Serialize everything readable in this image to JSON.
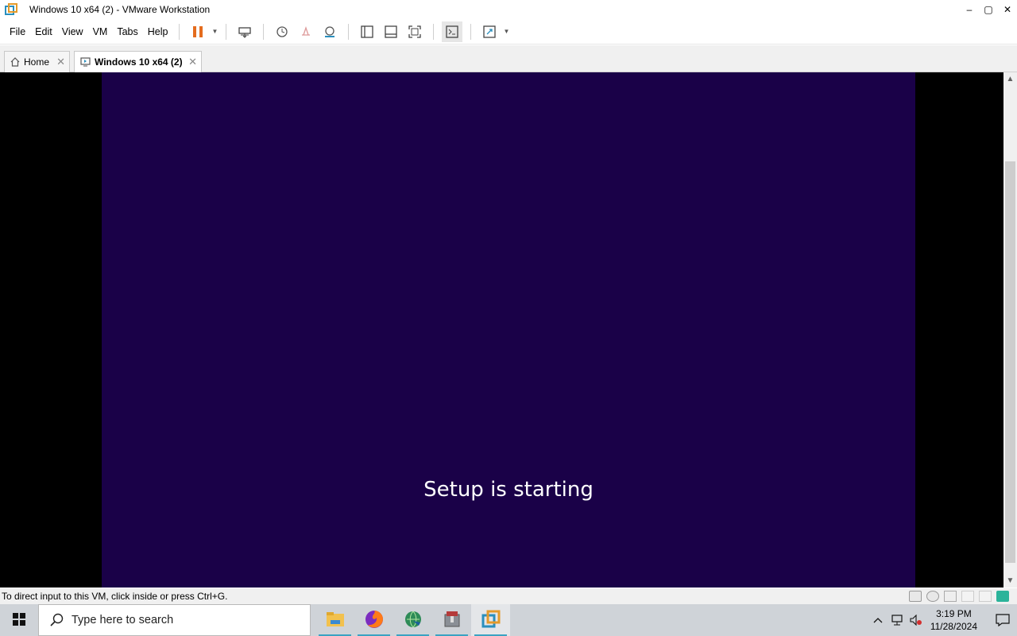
{
  "window": {
    "title": "Windows 10 x64 (2) - VMware Workstation",
    "controls": {
      "minimize": "–",
      "maximize": "▢",
      "close": "✕"
    }
  },
  "menu": {
    "items": [
      {
        "label": "File"
      },
      {
        "label": "Edit"
      },
      {
        "label": "View"
      },
      {
        "label": "VM"
      },
      {
        "label": "Tabs"
      },
      {
        "label": "Help"
      }
    ]
  },
  "toolbar": {
    "icons": [
      "pause-icon",
      "dropdown-icon",
      "send-ctrl-alt-del-icon",
      "snapshot-icon",
      "revert-snapshot-icon",
      "snapshot-manager-icon",
      "show-library-icon",
      "thumbnail-bar-icon",
      "fit-guest-icon",
      "console-view-icon",
      "full-screen-icon",
      "dropdown-icon"
    ],
    "accent": "#e46c1e"
  },
  "tabs": [
    {
      "label": "Home",
      "close": "✕",
      "icon": "home-icon"
    },
    {
      "label": "Windows 10 x64 (2)",
      "close": "✕",
      "icon": "vm-icon",
      "active": true
    }
  ],
  "guest": {
    "message": "Setup is starting",
    "background": "#1a0148"
  },
  "status": {
    "message": "To direct input to this VM, click inside or press Ctrl+G."
  },
  "taskbar": {
    "search_placeholder": "Type here to search",
    "apps": [
      "file-explorer-icon",
      "firefox-icon",
      "internet-download-manager-icon",
      "archive-app-icon",
      "vmware-workstation-icon"
    ],
    "time": "3:19 PM",
    "date": "11/28/2024"
  }
}
